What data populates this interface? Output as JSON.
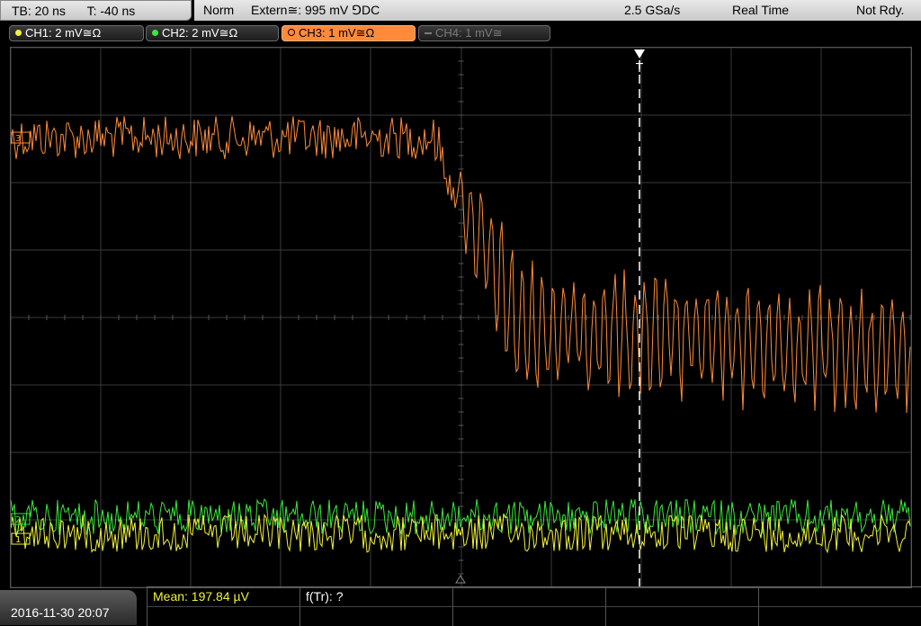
{
  "status_bar": {
    "timebase": "TB: 20 ns",
    "trigger_offset": "T: -40 ns",
    "trigger_mode": "Norm",
    "trigger_source": "Extern≅: 995 mV ⅁DC",
    "sample_rate": "2.5 GSa/s",
    "acq_mode": "Real Time",
    "state": "Not Rdy."
  },
  "channels": [
    {
      "label": "CH1: 2 mV≅Ω",
      "color": "#f2f23a",
      "active": true
    },
    {
      "label": "CH2: 2 mV≅Ω",
      "color": "#3ae83a",
      "active": true
    },
    {
      "label": "CH3: 1 mV≅Ω",
      "color": "#ff8c3a",
      "active": true,
      "selected": true
    },
    {
      "label": "CH4: 1 mV≅",
      "color": "#7a7a7a",
      "active": false
    }
  ],
  "markers": {
    "trigger_marker": "T",
    "ch1_ref": "1",
    "ch2_ref": "2",
    "ch3_ref": "3"
  },
  "bottom": {
    "datetime": "2016-11-30 20:07",
    "mean": "Mean: 197.84 µV",
    "rise_time": "f(Tr): ?"
  },
  "colors": {
    "ch1": "#f2f23a",
    "ch2": "#3ae83a",
    "ch3": "#ff8c3a",
    "grid": "#3a3a3a"
  }
}
